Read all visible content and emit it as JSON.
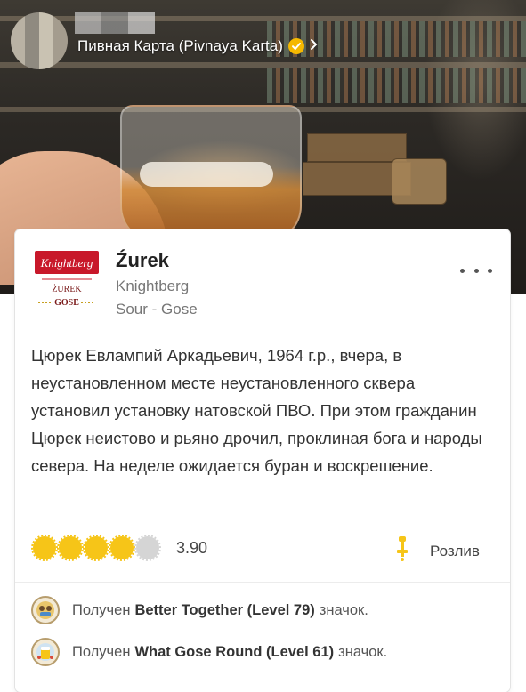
{
  "header": {
    "venue_name": "Пивная Карта (Pivnaya Karta)",
    "verified_icon": "check-badge-icon",
    "chevron_icon": "chevron-right-icon"
  },
  "checkin": {
    "label_text_top": "Knightberg",
    "label_text_mid": "ŻUREK",
    "label_text_bottom": "GOSE",
    "beer_name": "Źurek",
    "brewery": "Knightberg",
    "style": "Sour - Gose",
    "review": "Цюрек Евлампий Аркадьевич, 1964 г.р., вчера, в неустановленном месте неустановленного сквера установил установку натовской ПВО. При этом гражданин Цюрек неистово и рьяно дрочил, проклиная бога и народы севера. На неделе ожидается буран и воскрешение.",
    "rating_value": "3.90",
    "rating_caps_filled": 4,
    "rating_caps_total": 5,
    "serving_label": "Розлив",
    "serving_icon": "tap-icon"
  },
  "badges": [
    {
      "prefix": "Получен",
      "name": "Better Together (Level 79)",
      "suffix": "значок."
    },
    {
      "prefix": "Получен",
      "name": "What Gose Round (Level 61)",
      "suffix": "значок."
    }
  ],
  "colors": {
    "accent": "#f6c518",
    "cap_empty": "#d5d5d5",
    "label_red": "#c8182a"
  }
}
